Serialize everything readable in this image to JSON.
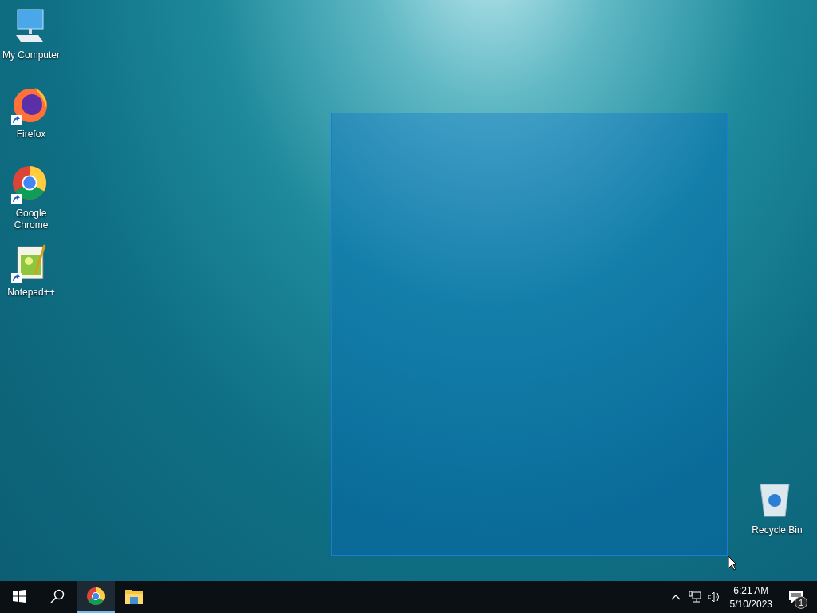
{
  "desktop": {
    "icons": [
      {
        "kind": "computer",
        "label": "My Computer",
        "shortcut": false
      },
      {
        "kind": "firefox",
        "label": "Firefox",
        "shortcut": true
      },
      {
        "kind": "chrome",
        "label": "Google Chrome",
        "shortcut": true
      },
      {
        "kind": "notepad",
        "label": "Notepad++",
        "shortcut": true
      },
      {
        "kind": "recycle",
        "label": "Recycle Bin",
        "shortcut": false
      }
    ]
  },
  "taskbar": {
    "apps": [
      {
        "kind": "start",
        "running": false
      },
      {
        "kind": "search",
        "running": false
      },
      {
        "kind": "chrome",
        "running": true
      },
      {
        "kind": "explorer",
        "running": false
      }
    ],
    "tray": {
      "time": "6:21 AM",
      "date": "5/10/2023",
      "notifications": "1"
    }
  }
}
